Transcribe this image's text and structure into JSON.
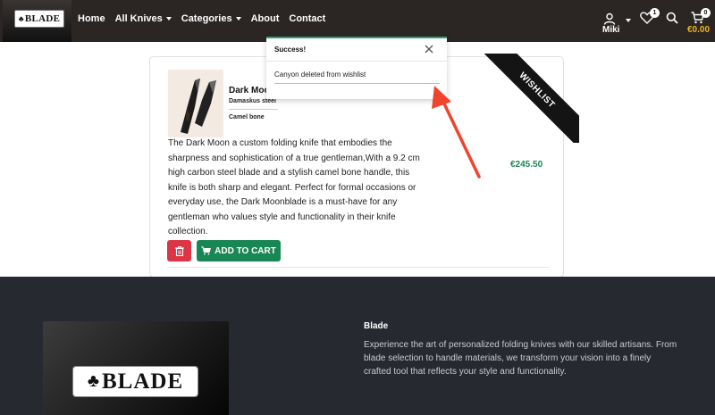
{
  "brand": {
    "logo_text": "BLADE"
  },
  "nav": {
    "links": [
      "Home",
      "All Knives",
      "Categories",
      "About",
      "Contact"
    ]
  },
  "header": {
    "user_name": "Miki",
    "wishlist_count": "1",
    "cart_count": "0",
    "cart_total": "€0.00"
  },
  "product": {
    "ribbon": "WISHLIST",
    "title": "Dark Moon",
    "spec_blade": "Damaskus steel",
    "spec_handle": "Camel bone",
    "description": "The Dark Moon a custom folding knife that embodies the sharpness and sophistication of a true gentleman,With a 9.2 cm high carbon steel blade and a stylish camel bone handle, this knife is both sharp and elegant. Perfect for formal occasions or everyday use, the Dark Moonblade is a must-have for any gentleman who values style and functionality in their knife collection.",
    "price": "€245.50",
    "add_to_cart_label": "ADD TO CART"
  },
  "toast": {
    "title": "Success!",
    "message": "Canyon deleted from wishlist"
  },
  "footer": {
    "logo_text": "BLADE",
    "title": "Blade",
    "text": "Experience the art of personalized folding knives with our skilled artisans. From blade selection to handle materials, we transform your vision into a finely crafted tool that reflects your style and functionality."
  },
  "colors": {
    "navbar": "#2b2624",
    "accent_price": "#198754",
    "delete": "#dc3545",
    "cart_total": "#f1b31c",
    "footer": "#262a30",
    "annotation_arrow": "#f0442c"
  },
  "icons": [
    "user-icon",
    "heart-icon",
    "search-icon",
    "cart-icon",
    "trash-icon",
    "close-icon",
    "cart-small-icon",
    "arrow-annotation"
  ]
}
